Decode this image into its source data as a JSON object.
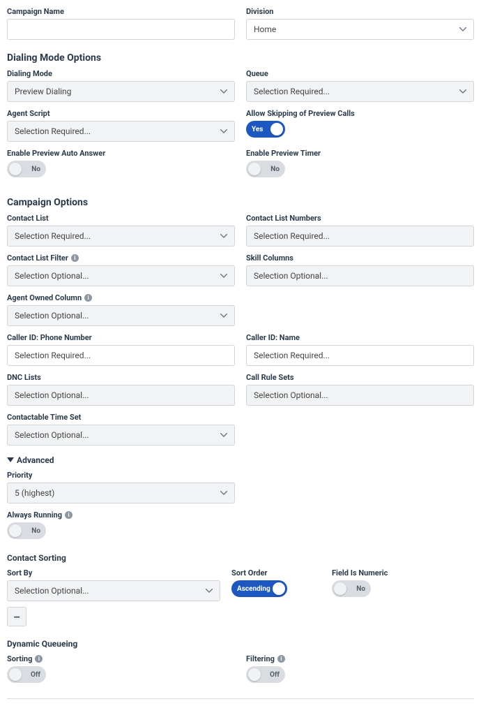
{
  "campaignName": {
    "label": "Campaign Name",
    "value": ""
  },
  "division": {
    "label": "Division",
    "value": "Home"
  },
  "dialingModeOptions": {
    "title": "Dialing Mode Options",
    "dialingMode": {
      "label": "Dialing Mode",
      "value": "Preview Dialing"
    },
    "queue": {
      "label": "Queue",
      "value": "Selection Required..."
    },
    "agentScript": {
      "label": "Agent Script",
      "value": "Selection Required..."
    },
    "allowSkipping": {
      "label": "Allow Skipping of Preview Calls",
      "value": "Yes"
    },
    "enablePreviewAutoAnswer": {
      "label": "Enable Preview Auto Answer",
      "value": "No"
    },
    "enablePreviewTimer": {
      "label": "Enable Preview Timer",
      "value": "No"
    }
  },
  "campaignOptions": {
    "title": "Campaign Options",
    "contactList": {
      "label": "Contact List",
      "value": "Selection Required..."
    },
    "contactListNumbers": {
      "label": "Contact List Numbers",
      "value": "Selection Required..."
    },
    "contactListFilter": {
      "label": "Contact List Filter",
      "value": "Selection Optional..."
    },
    "skillColumns": {
      "label": "Skill Columns",
      "value": "Selection Optional..."
    },
    "agentOwnedColumn": {
      "label": "Agent Owned Column",
      "value": "Selection Optional..."
    },
    "callerIdPhone": {
      "label": "Caller ID: Phone Number",
      "value": "Selection Required..."
    },
    "callerIdName": {
      "label": "Caller ID: Name",
      "value": "Selection Required..."
    },
    "dncLists": {
      "label": "DNC Lists",
      "value": "Selection Optional..."
    },
    "callRuleSets": {
      "label": "Call Rule Sets",
      "value": "Selection Optional..."
    },
    "contactableTimeSet": {
      "label": "Contactable Time Set",
      "value": "Selection Optional..."
    }
  },
  "advanced": {
    "title": "Advanced",
    "priority": {
      "label": "Priority",
      "value": "5 (highest)"
    },
    "alwaysRunning": {
      "label": "Always Running",
      "value": "No"
    }
  },
  "contactSorting": {
    "title": "Contact Sorting",
    "sortBy": {
      "label": "Sort By",
      "value": "Selection Optional..."
    },
    "sortOrder": {
      "label": "Sort Order",
      "value": "Ascending"
    },
    "fieldIsNumeric": {
      "label": "Field Is Numeric",
      "value": "No"
    },
    "removeLabel": "–"
  },
  "dynamicQueueing": {
    "title": "Dynamic Queueing",
    "sorting": {
      "label": "Sorting",
      "value": "Off"
    },
    "filtering": {
      "label": "Filtering",
      "value": "Off"
    }
  }
}
